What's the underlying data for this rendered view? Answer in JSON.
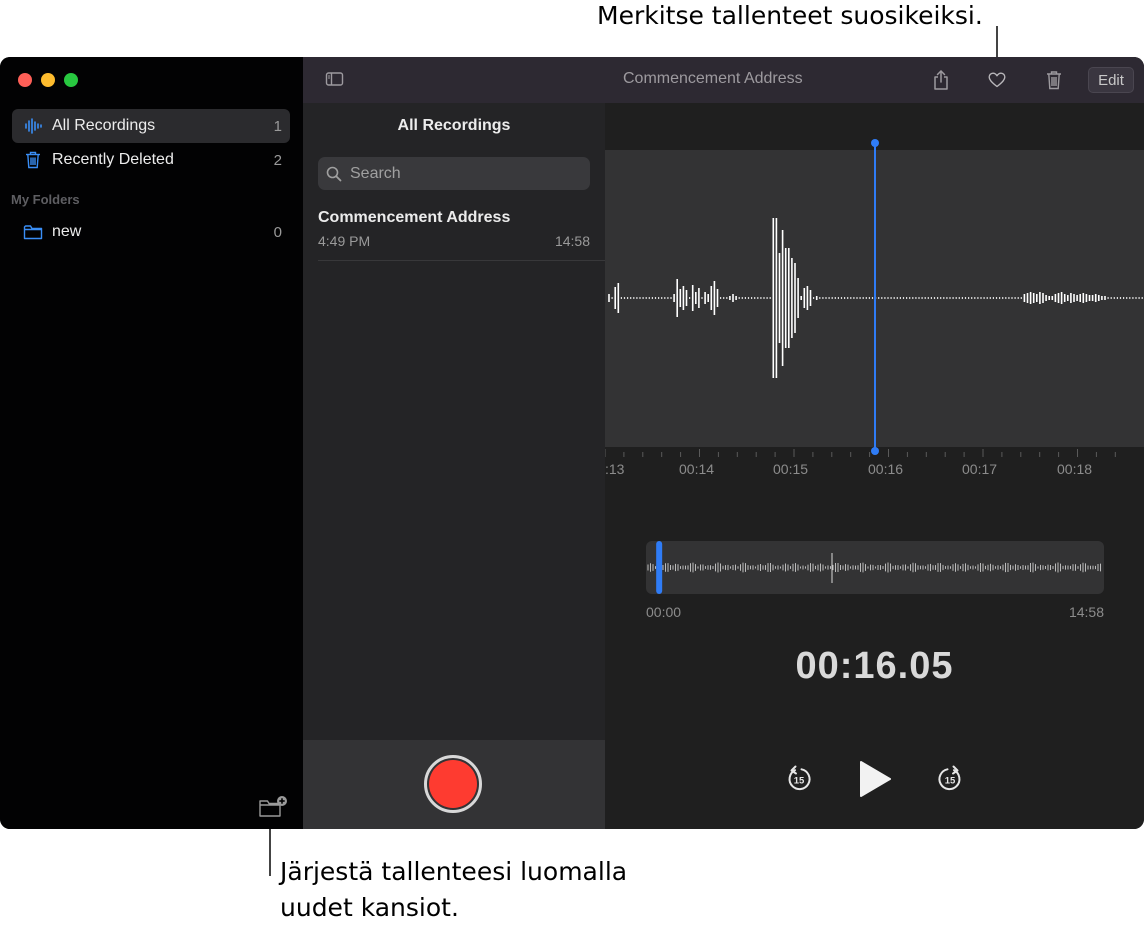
{
  "callouts": {
    "favorite": "Merkitse tallenteet suosikeiksi.",
    "folders_line1": "Järjestä tallenteesi luomalla",
    "folders_line2": "uudet kansiot."
  },
  "sidebar": {
    "items": [
      {
        "label": "All Recordings",
        "count": "1",
        "icon": "waveform-icon"
      },
      {
        "label": "Recently Deleted",
        "count": "2",
        "icon": "trash-icon"
      }
    ],
    "section": "My Folders",
    "folders": [
      {
        "label": "new",
        "count": "0",
        "icon": "folder-icon"
      }
    ]
  },
  "list": {
    "title": "All Recordings",
    "search_placeholder": "Search",
    "recordings": [
      {
        "name": "Commencement Address",
        "time": "4:49 PM",
        "duration": "14:58"
      }
    ]
  },
  "toolbar": {
    "title": "Commencement Address",
    "edit_label": "Edit"
  },
  "player": {
    "timeline_ticks": [
      ":13",
      "00:14",
      "00:15",
      "00:16",
      "00:17",
      "00:18"
    ],
    "overview_start": "00:00",
    "overview_end": "14:58",
    "current_time": "00:16.05",
    "skip_back_seconds": "15",
    "skip_forward_seconds": "15",
    "playhead_fraction": 0.018
  },
  "colors": {
    "accent": "#2f7cf6",
    "record": "#fe3b30",
    "sidebar_icon": "#3a8ef6"
  }
}
